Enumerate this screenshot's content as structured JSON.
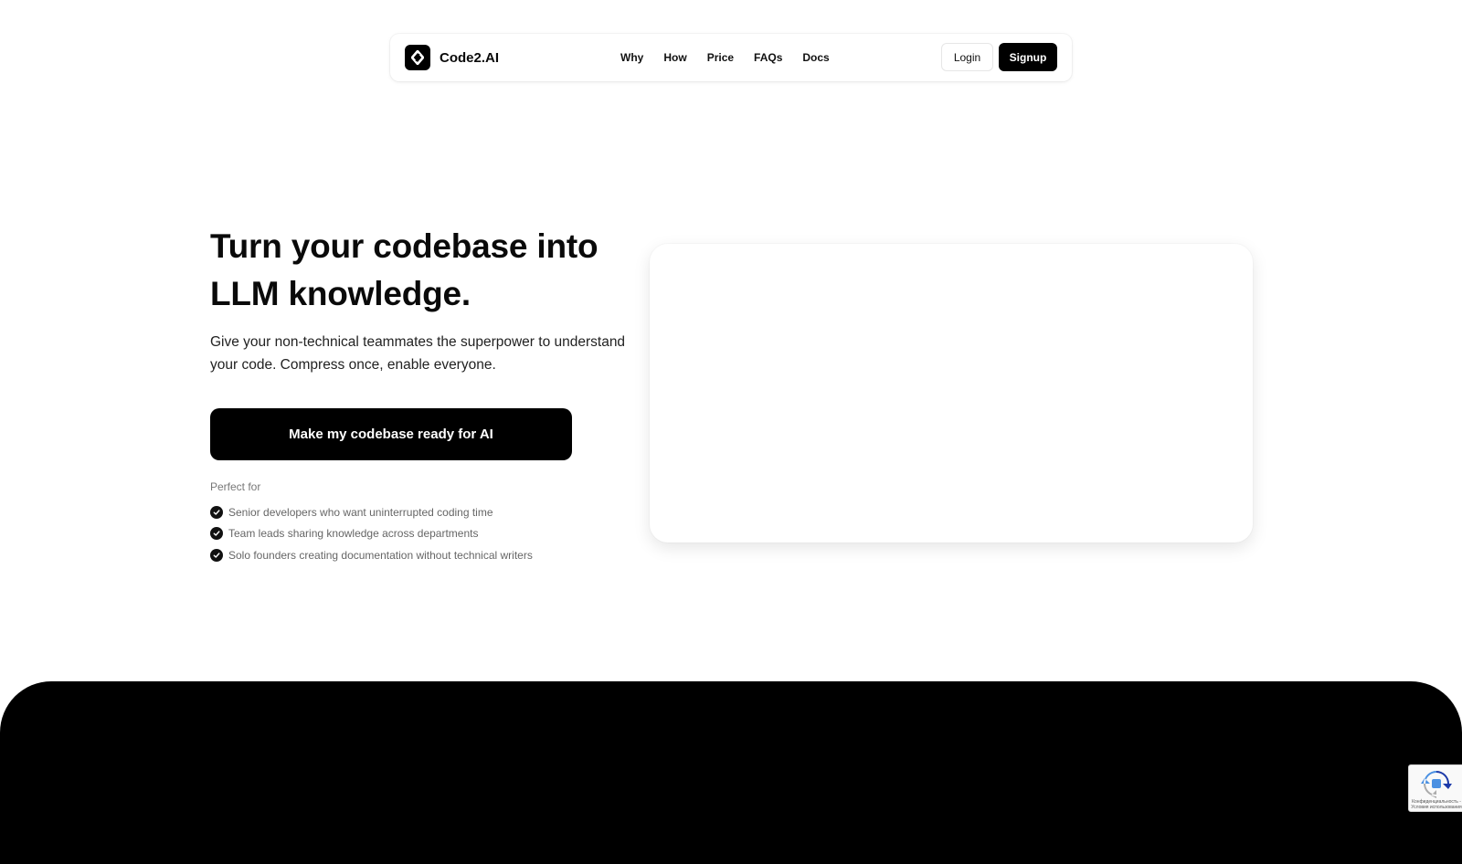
{
  "navbar": {
    "brand": "Code2.AI",
    "links": [
      "Why",
      "How",
      "Price",
      "FAQs",
      "Docs"
    ],
    "login_label": "Login",
    "signup_label": "Signup"
  },
  "hero": {
    "title_line1": "Turn your codebase into",
    "title_line2": "LLM knowledge.",
    "subtitle_line1": "Give your non-technical teammates the superpower to understand",
    "subtitle_line2": "your code. Compress once, enable everyone.",
    "cta_label": "Make my codebase ready for AI",
    "perfect_for_label": "Perfect for",
    "perfect_for_items": [
      "Senior developers who want uninterrupted coding time",
      "Team leads sharing knowledge across departments",
      "Solo founders creating documentation without technical writers"
    ]
  },
  "recaptcha": {
    "text_line1": "Конфиденциальность -",
    "text_line2": "Условия использования"
  },
  "colors": {
    "primary": "#000000",
    "background": "#ffffff",
    "muted_text": "#777777"
  }
}
